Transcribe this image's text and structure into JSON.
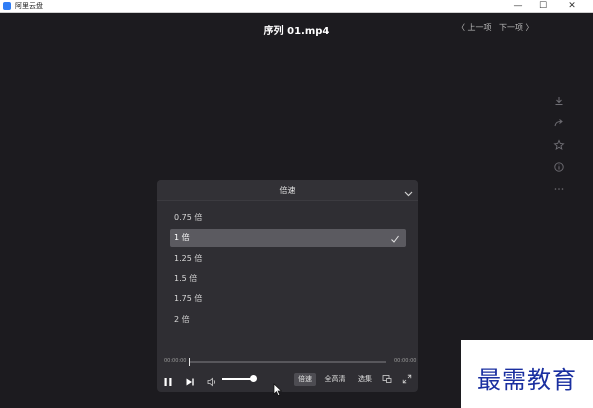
{
  "window": {
    "app_title": "阿里云盘",
    "minimize_glyph": "—",
    "maximize_glyph": "☐",
    "close_glyph": "✕"
  },
  "header": {
    "file_title": "序列 01.mp4",
    "prev_label": "〈 上一项",
    "next_label": "下一项 〉"
  },
  "side_actions": [
    {
      "icon": "download-icon"
    },
    {
      "icon": "share-icon"
    },
    {
      "icon": "star-icon"
    },
    {
      "icon": "info-icon"
    },
    {
      "icon": "more-icon"
    }
  ],
  "speed_panel": {
    "title": "倍速",
    "options": [
      {
        "label": "0.75 倍",
        "selected": false
      },
      {
        "label": "1 倍",
        "selected": true
      },
      {
        "label": "1.25 倍",
        "selected": false
      },
      {
        "label": "1.5 倍",
        "selected": false
      },
      {
        "label": "1.75 倍",
        "selected": false
      },
      {
        "label": "2 倍",
        "selected": false
      }
    ]
  },
  "player": {
    "time_current": "00:00:00",
    "time_total": "00:00:00",
    "progress": 0.0,
    "volume": 1.0,
    "speed_label": "倍速",
    "quality_label": "全高清",
    "episodes_label": "选集"
  },
  "watermark": {
    "text": "最需教育"
  },
  "colors": {
    "background": "#1c1b1f",
    "panel": "#2f2e33",
    "selected_row": "#5b5a60",
    "watermark_text": "#1a2fa0"
  }
}
